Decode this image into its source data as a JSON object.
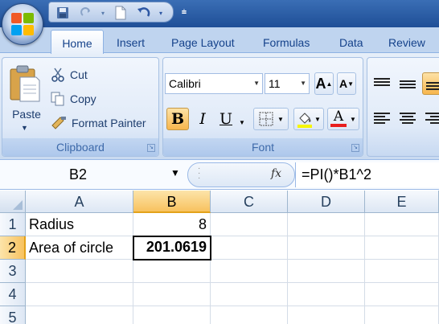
{
  "qat": {
    "icons": [
      "office-logo",
      "save-icon",
      "redo-icon",
      "new-icon",
      "undo-icon",
      "customize-icon"
    ]
  },
  "tabs": [
    {
      "label": "Home"
    },
    {
      "label": "Insert"
    },
    {
      "label": "Page Layout"
    },
    {
      "label": "Formulas"
    },
    {
      "label": "Data"
    },
    {
      "label": "Review"
    }
  ],
  "clipboard": {
    "paste_label": "Paste",
    "cut_label": "Cut",
    "copy_label": "Copy",
    "format_painter_label": "Format Painter",
    "group_label": "Clipboard"
  },
  "font": {
    "font_name": "Calibri",
    "font_size": "11",
    "bold_label": "B",
    "italic_label": "I",
    "underline_label": "U",
    "font_color_label": "A",
    "grow_label": "A",
    "shrink_label": "A",
    "group_label": "Font",
    "font_color": "#e81e1e",
    "highlight_color": "#f6f600"
  },
  "formula_bar": {
    "name_box": "B2",
    "fx_label": "fx",
    "formula": "=PI()*B1^2"
  },
  "grid": {
    "columns": [
      "A",
      "B",
      "C",
      "D",
      "E"
    ],
    "rows": [
      "1",
      "2",
      "3",
      "4",
      "5"
    ],
    "cells": {
      "A1": "Radius",
      "B1": "8",
      "A2": "Area of circle",
      "B2": "201.0619"
    },
    "active_cell": "B2"
  },
  "colors": {
    "title_bar": "#2a5ea8",
    "ribbon": "#dbe7f6",
    "selection_header": "#f8c25f"
  }
}
